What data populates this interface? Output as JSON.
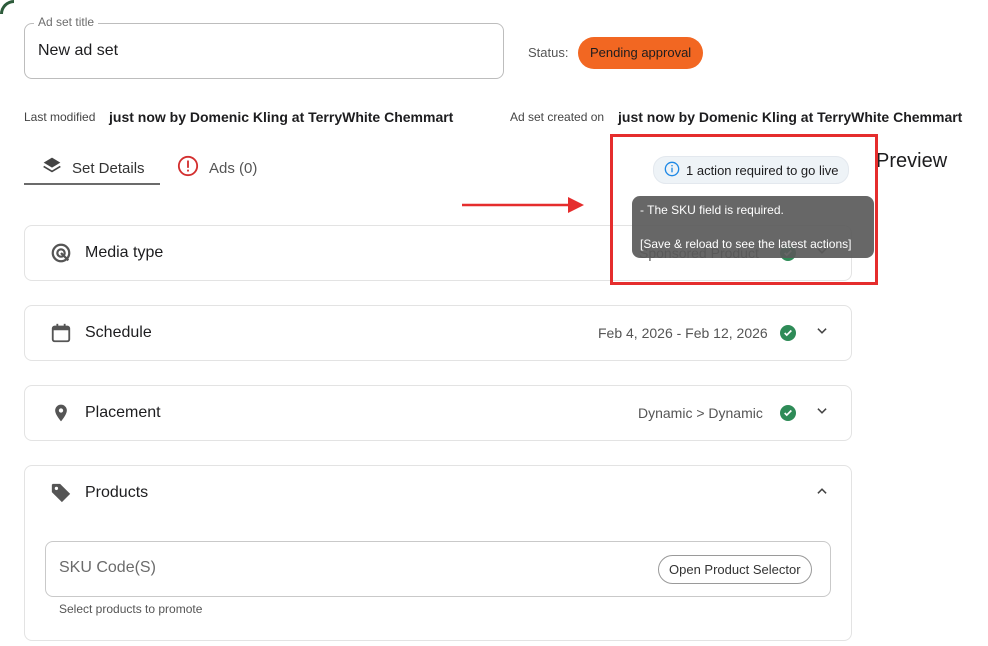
{
  "title_field": {
    "legend": "Ad set title",
    "value": "New ad set"
  },
  "status": {
    "label": "Status:",
    "badge": "Pending approval",
    "badge_color": "#f26722"
  },
  "meta": {
    "last_modified_label": "Last modified",
    "last_modified_value": "just now by Domenic Kling at TerryWhite Chemmart",
    "created_label": "Ad set created on",
    "created_value": "just now by Domenic Kling at TerryWhite Chemmart"
  },
  "tabs": [
    {
      "label": "Set Details",
      "icon": "layers-icon",
      "active": true
    },
    {
      "label": "Ads (0)",
      "icon": "alert-circle-icon",
      "active": false
    }
  ],
  "action_chip": {
    "icon": "info-icon",
    "label": "1 action required to go live"
  },
  "preview_label": "Preview",
  "tooltip": {
    "line1": "- The SKU field is required.",
    "line2": "[Save & reload to see the latest actions]"
  },
  "sections": [
    {
      "title": "Media type",
      "icon": "target-icon",
      "summary": "Sponsored Product"
    },
    {
      "title": "Schedule",
      "icon": "calendar-icon",
      "summary": "Feb 4, 2026 - Feb 12, 2026"
    },
    {
      "title": "Placement",
      "icon": "location-pin-icon",
      "summary": "Dynamic > Dynamic"
    },
    {
      "title": "Products",
      "icon": "tag-icon"
    }
  ],
  "products": {
    "sku_placeholder": "SKU Code(S)",
    "open_selector_label": "Open Product Selector",
    "helper_text": "Select products to promote"
  },
  "colors": {
    "accent_green": "#2e8b57",
    "highlight_red": "#e52d2d",
    "tooltip_bg": "#5a5a5a"
  }
}
